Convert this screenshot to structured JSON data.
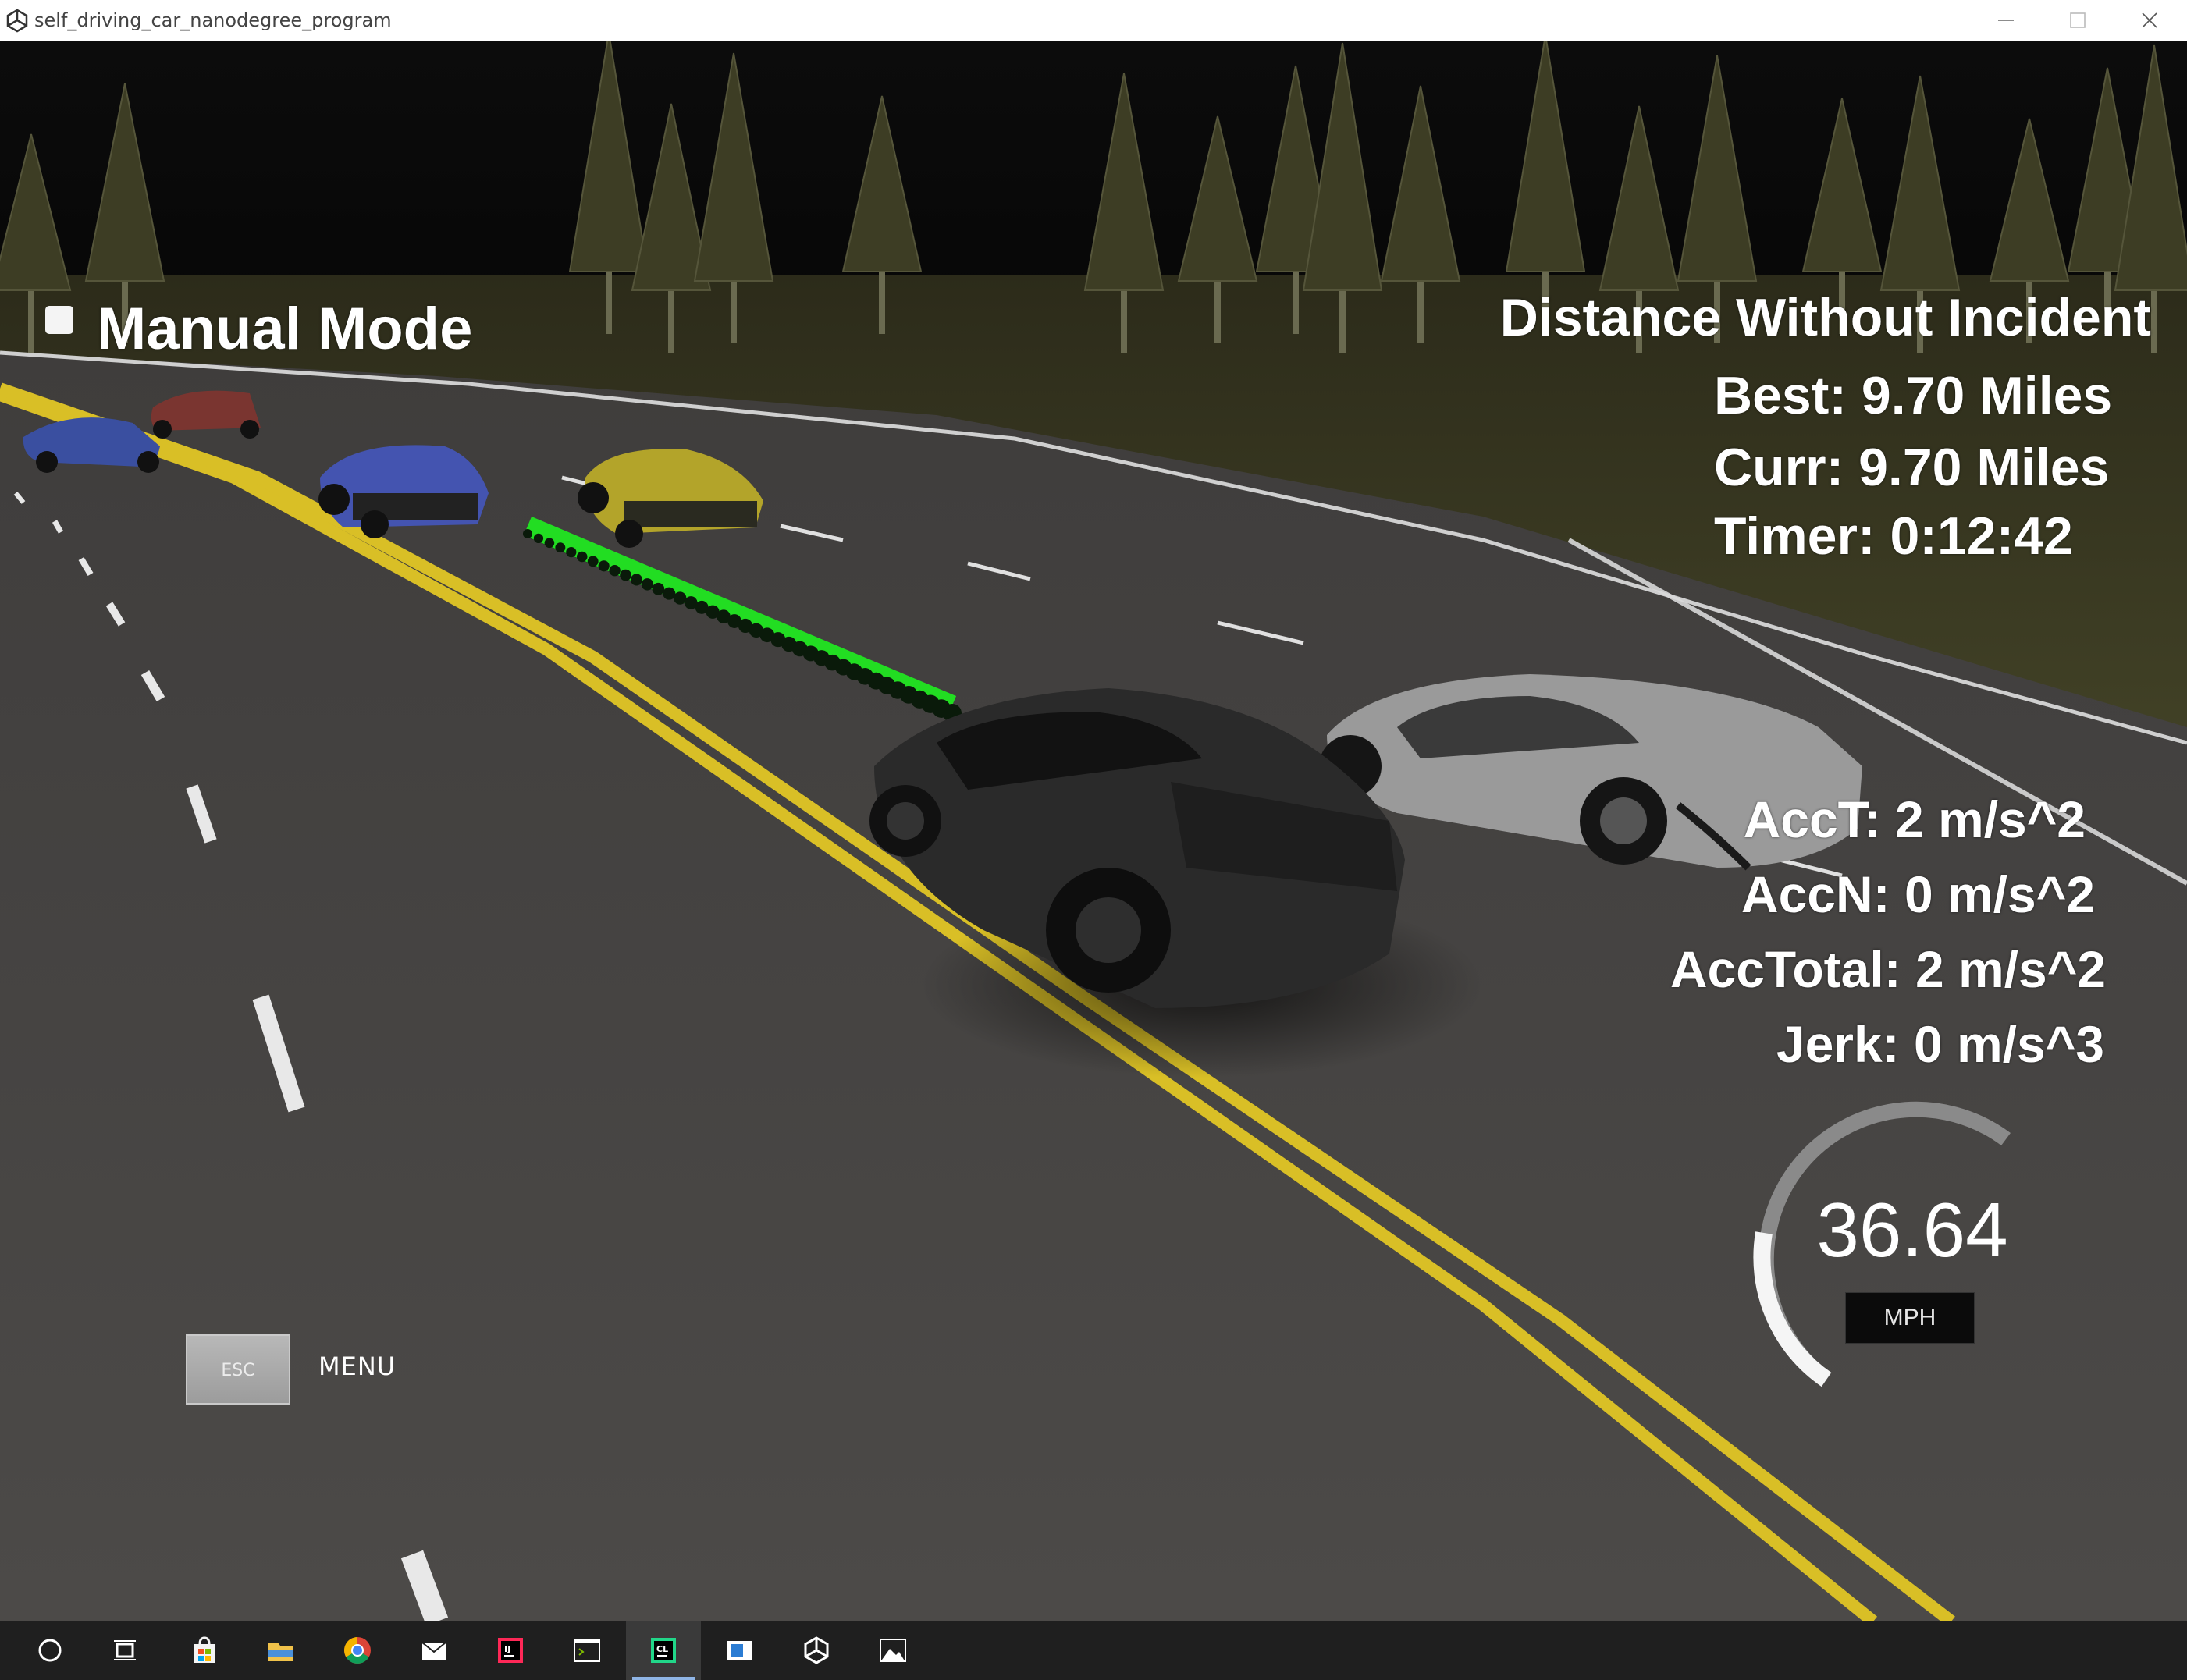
{
  "window": {
    "title": "self_driving_car_nanodegree_program",
    "icon": "unity-icon",
    "controls": [
      "minimize-icon",
      "maximize-icon",
      "close-icon"
    ]
  },
  "hud": {
    "mode_label": "Manual Mode",
    "distance_title": "Distance Without Incident",
    "best": "Best: 9.70 Miles",
    "curr": "Curr: 9.70 Miles",
    "timer": "Timer: 0:12:42",
    "acc_t": "AccT: 2 m/s^2",
    "acc_n": "AccN: 0 m/s^2",
    "acc_total": "AccTotal: 2 m/s^2",
    "jerk": "Jerk: 0 m/s^3",
    "speed": "36.64",
    "speed_unit": "MPH",
    "esc_label": "ESC",
    "menu_label": "MENU"
  },
  "scene": {
    "sky_color": "#060606",
    "grass_color": "#3b3b22",
    "road_color": "#4a4847",
    "center_line_color": "#e2c52a",
    "trajectory_color": "#22dd22",
    "cars": [
      {
        "name": "blue-car-far",
        "color": "#3a4fa0"
      },
      {
        "name": "red-car-far",
        "color": "#7a3530"
      },
      {
        "name": "blue-car",
        "color": "#4454b0"
      },
      {
        "name": "yellow-car",
        "color": "#b3a42a"
      },
      {
        "name": "ego-car",
        "color": "#2a2a2a"
      },
      {
        "name": "silver-car",
        "color": "#9a9a9a"
      }
    ]
  },
  "taskbar": {
    "items": [
      {
        "name": "cortana-search-icon"
      },
      {
        "name": "task-view-icon"
      },
      {
        "name": "store-icon"
      },
      {
        "name": "file-explorer-icon"
      },
      {
        "name": "chrome-icon"
      },
      {
        "name": "mail-icon"
      },
      {
        "name": "intellij-icon"
      },
      {
        "name": "terminal-icon"
      },
      {
        "name": "clion-icon",
        "active": true
      },
      {
        "name": "window-app-icon"
      },
      {
        "name": "unity-icon"
      },
      {
        "name": "photos-icon"
      }
    ]
  }
}
